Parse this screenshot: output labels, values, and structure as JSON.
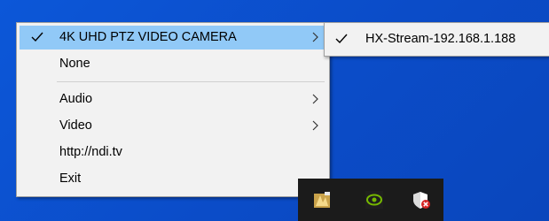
{
  "menu": {
    "items": [
      {
        "label": "4K UHD PTZ VIDEO CAMERA",
        "checked": true,
        "submenu": true,
        "highlighted": true
      },
      {
        "label": "None",
        "checked": false,
        "submenu": false
      },
      {
        "label": "Audio",
        "checked": false,
        "submenu": true
      },
      {
        "label": "Video",
        "checked": false,
        "submenu": true
      },
      {
        "label": "http://ndi.tv",
        "checked": false,
        "submenu": false
      },
      {
        "label": "Exit",
        "checked": false,
        "submenu": false
      }
    ]
  },
  "submenu": {
    "items": [
      {
        "label": "HX-Stream-192.168.1.188",
        "checked": true
      }
    ]
  },
  "tray": {
    "icons": [
      "ndi-tray-icon",
      "nvidia-icon",
      "windows-security-alert-icon"
    ]
  },
  "colors": {
    "desktop": "#0b4cc8",
    "menu_bg": "#f2f2f2",
    "highlight": "#91c9f7",
    "taskbar": "#1b1b1b"
  }
}
